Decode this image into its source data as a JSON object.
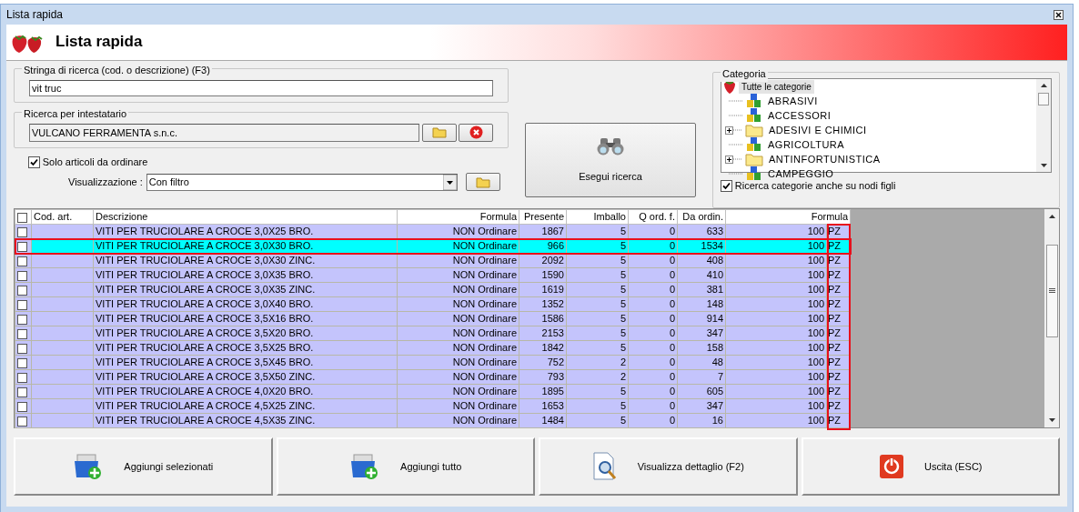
{
  "window": {
    "title": "Lista rapida"
  },
  "header": {
    "title": "Lista rapida"
  },
  "search_group": {
    "label": "Stringa di ricerca (cod. o descrizione) (F3)",
    "value": "vit truc"
  },
  "owner_group": {
    "label": "Ricerca per intestatario",
    "value": "VULCANO FERRAMENTA s.n.c."
  },
  "only_to_order": {
    "label": "Solo articoli da ordinare",
    "checked": true
  },
  "view": {
    "label": "Visualizzazione :",
    "value": "Con filtro"
  },
  "search_button": {
    "label": "Esegui ricerca"
  },
  "category": {
    "label": "Categoria",
    "tree": [
      {
        "label": "Tutte le categorie",
        "kind": "root",
        "selected": true,
        "children": [
          {
            "label": "ABRASIVI",
            "kind": "leaf",
            "selected": false
          },
          {
            "label": "ACCESSORI",
            "kind": "leaf",
            "selected": false
          },
          {
            "label": "ADESIVI E CHIMICI",
            "kind": "folder",
            "selected": false
          },
          {
            "label": "AGRICOLTURA",
            "kind": "leaf",
            "selected": false
          },
          {
            "label": "ANTINFORTUNISTICA",
            "kind": "folder",
            "selected": false
          },
          {
            "label": "CAMPEGGIO",
            "kind": "leaf",
            "selected": false
          }
        ]
      }
    ],
    "include_children": {
      "label": "Ricerca categorie anche su nodi figli",
      "checked": true
    }
  },
  "table": {
    "header_checked": false,
    "columns": [
      "Cod. art.",
      "Descrizione",
      "Formula",
      "Presente",
      "Imballo",
      "Q ord. f.",
      "Da ordin.",
      "Formula"
    ],
    "unit_column_highlighted": true,
    "rows": [
      {
        "checked": false,
        "selected": false,
        "description": "VITI PER TRUCIOLARE A CROCE 3,0X25 BRO.",
        "status": "NON Ordinare",
        "present": "1867",
        "pack": "5",
        "ordered": "0",
        "to_order": "633",
        "qty": "100",
        "unit": "PZ"
      },
      {
        "checked": false,
        "selected": true,
        "description": "VITI PER TRUCIOLARE A CROCE 3,0X30 BRO.",
        "status": "NON Ordinare",
        "present": "966",
        "pack": "5",
        "ordered": "0",
        "to_order": "1534",
        "qty": "100",
        "unit": "PZ"
      },
      {
        "checked": false,
        "selected": false,
        "description": "VITI PER TRUCIOLARE A CROCE 3,0X30 ZINC.",
        "status": "NON Ordinare",
        "present": "2092",
        "pack": "5",
        "ordered": "0",
        "to_order": "408",
        "qty": "100",
        "unit": "PZ"
      },
      {
        "checked": false,
        "selected": false,
        "description": "VITI PER TRUCIOLARE A CROCE 3,0X35 BRO.",
        "status": "NON Ordinare",
        "present": "1590",
        "pack": "5",
        "ordered": "0",
        "to_order": "410",
        "qty": "100",
        "unit": "PZ"
      },
      {
        "checked": false,
        "selected": false,
        "description": "VITI PER TRUCIOLARE A CROCE 3,0X35 ZINC.",
        "status": "NON Ordinare",
        "present": "1619",
        "pack": "5",
        "ordered": "0",
        "to_order": "381",
        "qty": "100",
        "unit": "PZ"
      },
      {
        "checked": false,
        "selected": false,
        "description": "VITI PER TRUCIOLARE A CROCE 3,0X40 BRO.",
        "status": "NON Ordinare",
        "present": "1352",
        "pack": "5",
        "ordered": "0",
        "to_order": "148",
        "qty": "100",
        "unit": "PZ"
      },
      {
        "checked": false,
        "selected": false,
        "description": "VITI PER TRUCIOLARE A CROCE 3,5X16 BRO.",
        "status": "NON Ordinare",
        "present": "1586",
        "pack": "5",
        "ordered": "0",
        "to_order": "914",
        "qty": "100",
        "unit": "PZ"
      },
      {
        "checked": false,
        "selected": false,
        "description": "VITI PER TRUCIOLARE A CROCE 3,5X20 BRO.",
        "status": "NON Ordinare",
        "present": "2153",
        "pack": "5",
        "ordered": "0",
        "to_order": "347",
        "qty": "100",
        "unit": "PZ"
      },
      {
        "checked": false,
        "selected": false,
        "description": "VITI PER TRUCIOLARE A CROCE 3,5X25 BRO.",
        "status": "NON Ordinare",
        "present": "1842",
        "pack": "5",
        "ordered": "0",
        "to_order": "158",
        "qty": "100",
        "unit": "PZ"
      },
      {
        "checked": false,
        "selected": false,
        "description": "VITI PER TRUCIOLARE A CROCE 3,5X45 BRO.",
        "status": "NON Ordinare",
        "present": "752",
        "pack": "2",
        "ordered": "0",
        "to_order": "48",
        "qty": "100",
        "unit": "PZ"
      },
      {
        "checked": false,
        "selected": false,
        "description": "VITI PER TRUCIOLARE A CROCE 3,5X50 ZINC.",
        "status": "NON Ordinare",
        "present": "793",
        "pack": "2",
        "ordered": "0",
        "to_order": "7",
        "qty": "100",
        "unit": "PZ"
      },
      {
        "checked": false,
        "selected": false,
        "description": "VITI PER TRUCIOLARE A CROCE 4,0X20 BRO.",
        "status": "NON Ordinare",
        "present": "1895",
        "pack": "5",
        "ordered": "0",
        "to_order": "605",
        "qty": "100",
        "unit": "PZ"
      },
      {
        "checked": false,
        "selected": false,
        "description": "VITI PER TRUCIOLARE A CROCE 4,5X25 ZINC.",
        "status": "NON Ordinare",
        "present": "1653",
        "pack": "5",
        "ordered": "0",
        "to_order": "347",
        "qty": "100",
        "unit": "PZ"
      },
      {
        "checked": false,
        "selected": false,
        "description": "VITI PER TRUCIOLARE A CROCE 4,5X35 ZINC.",
        "status": "NON Ordinare",
        "present": "1484",
        "pack": "5",
        "ordered": "0",
        "to_order": "16",
        "qty": "100",
        "unit": "PZ"
      }
    ]
  },
  "buttons": [
    {
      "label": "Aggiungi selezionati",
      "kind": "add"
    },
    {
      "label": "Aggiungi tutto",
      "kind": "add"
    },
    {
      "label": "Visualizza dettaglio (F2)",
      "kind": "detail"
    },
    {
      "label": "Uscita (ESC)",
      "kind": "exit"
    }
  ]
}
